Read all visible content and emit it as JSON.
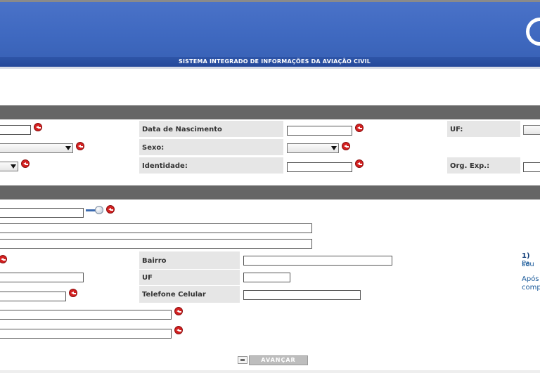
{
  "header": {
    "system_title": "SISTEMA INTEGRADO DE INFORMAÇÕES DA AVIAÇÃO CIVIL"
  },
  "personal": {
    "birth_date_label": "Data de Nascimento",
    "uf_label": "UF:",
    "sex_label": "Sexo:",
    "identity_label": "Identidade:",
    "org_exp_label": "Org. Exp.:"
  },
  "address": {
    "bairro_label": "Bairro",
    "uf_label": "UF",
    "mobile_label": "Telefone Celular"
  },
  "help": {
    "step_number": "1)",
    "line1": "Pa",
    "line2": "seu",
    "line3": "Após",
    "line4": "comp"
  },
  "actions": {
    "advance_label": "AVANÇAR"
  },
  "colors": {
    "banner": "#3f69c0",
    "section_header": "#666666",
    "required_icon": "#d42020"
  }
}
